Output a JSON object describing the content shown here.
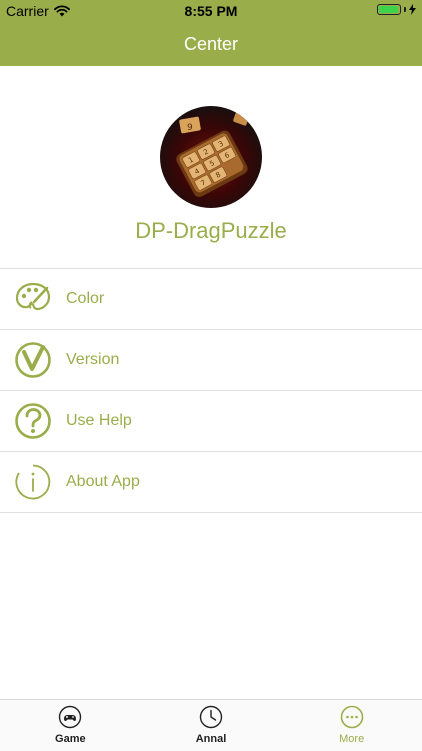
{
  "status_bar": {
    "carrier": "Carrier",
    "time": "8:55 PM"
  },
  "nav": {
    "title": "Center"
  },
  "header": {
    "app_name": "DP-DragPuzzle"
  },
  "menu": [
    {
      "label": "Color",
      "icon": "palette-icon"
    },
    {
      "label": "Version",
      "icon": "version-v-icon"
    },
    {
      "label": "Use Help",
      "icon": "question-icon"
    },
    {
      "label": "About App",
      "icon": "info-icon"
    }
  ],
  "tabs": [
    {
      "label": "Game",
      "icon": "gamepad-icon",
      "active": false
    },
    {
      "label": "Annal",
      "icon": "clock-icon",
      "active": false
    },
    {
      "label": "More",
      "icon": "more-dots-icon",
      "active": true
    }
  ],
  "colors": {
    "accent": "#9aad4b",
    "divider": "#e2e2e2"
  }
}
